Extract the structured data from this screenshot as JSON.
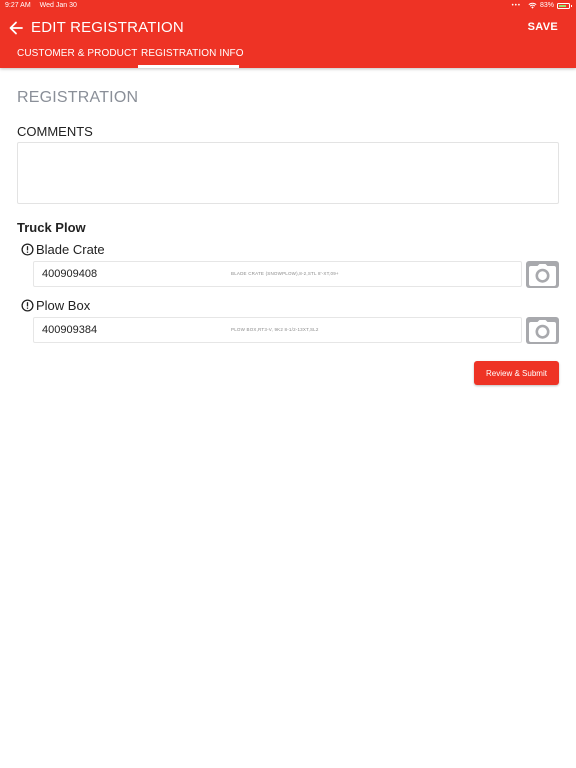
{
  "status_bar": {
    "time": "9:27 AM",
    "date": "Wed Jan 30",
    "battery": "83%",
    "battery_level": 0.83
  },
  "header": {
    "back_icon": "arrow-left-icon",
    "title": "EDIT REGISTRATION",
    "save_label": "SAVE",
    "background_color": "#ee3325"
  },
  "tabs": [
    {
      "label": "CUSTOMER & PRODUCT",
      "active": false
    },
    {
      "label": "REGISTRATION INFO",
      "active": true
    }
  ],
  "form": {
    "section_title": "REGISTRATION",
    "comments_label": "COMMENTS",
    "comments_value": "",
    "group_title": "Truck Plow",
    "items": [
      {
        "label": "Blade Crate",
        "serial": "400909408",
        "description": "BLADE CRATE (SNOWPLOW),8-2,STL 8'-XT,09+",
        "icon": "alert-circle-icon",
        "camera_icon": "camera-icon"
      },
      {
        "label": "Plow Box",
        "serial": "400909384",
        "description": "PLOW BOX,RT3-V, 9K2 8-1/2-13XT,SL2",
        "icon": "alert-circle-icon",
        "camera_icon": "camera-icon"
      }
    ],
    "submit_label": "Review & Submit"
  }
}
